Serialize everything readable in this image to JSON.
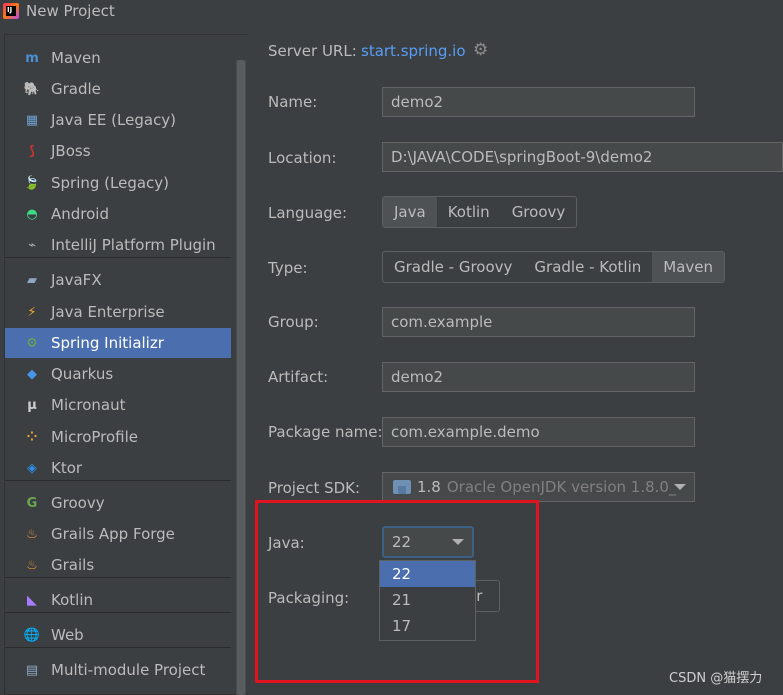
{
  "window": {
    "title": "New Project"
  },
  "sidebar": {
    "items": [
      {
        "label": "Maven",
        "icon": "maven-icon",
        "glyph": "m",
        "color": "#4b8fd6"
      },
      {
        "label": "Gradle",
        "icon": "gradle-icon",
        "glyph": "🐘",
        "color": "#a0a0a0"
      },
      {
        "label": "Java EE (Legacy)",
        "icon": "javaee-icon",
        "glyph": "▦",
        "color": "#6f9fd1"
      },
      {
        "label": "JBoss",
        "icon": "jboss-icon",
        "glyph": "⟆",
        "color": "#cc3333"
      },
      {
        "label": "Spring (Legacy)",
        "icon": "spring-leaf-icon",
        "glyph": "🍃",
        "color": "#6aa84f"
      },
      {
        "label": "Android",
        "icon": "android-icon",
        "glyph": "◓",
        "color": "#3ddc84"
      },
      {
        "label": "IntelliJ Platform Plugin",
        "icon": "plugin-icon",
        "glyph": "⌁",
        "color": "#aaaaaa"
      },
      {
        "label": "JavaFX",
        "icon": "javafx-icon",
        "glyph": "▰",
        "color": "#8fa7c4"
      },
      {
        "label": "Java Enterprise",
        "icon": "java-enterprise-icon",
        "glyph": "⚡",
        "color": "#f0a732"
      },
      {
        "label": "Spring Initializr",
        "icon": "spring-initializr-icon",
        "glyph": "⚙",
        "color": "#6aa84f"
      },
      {
        "label": "Quarkus",
        "icon": "quarkus-icon",
        "glyph": "◆",
        "color": "#4695eb"
      },
      {
        "label": "Micronaut",
        "icon": "micronaut-icon",
        "glyph": "μ",
        "color": "#cccccc"
      },
      {
        "label": "MicroProfile",
        "icon": "microprofile-icon",
        "glyph": "⁘",
        "color": "#f0a732"
      },
      {
        "label": "Ktor",
        "icon": "ktor-icon",
        "glyph": "◈",
        "color": "#2c8ee8"
      },
      {
        "label": "Groovy",
        "icon": "groovy-icon",
        "glyph": "G",
        "color": "#6aa84f"
      },
      {
        "label": "Grails App Forge",
        "icon": "grails-forge-icon",
        "glyph": "♨",
        "color": "#e8923c"
      },
      {
        "label": "Grails",
        "icon": "grails-icon",
        "glyph": "♨",
        "color": "#e8923c"
      },
      {
        "label": "Kotlin",
        "icon": "kotlin-icon",
        "glyph": "◣",
        "color": "#a97bff"
      },
      {
        "label": "Web",
        "icon": "globe-icon",
        "glyph": "🌐",
        "color": "#aaaaaa"
      },
      {
        "label": "Multi-module Project",
        "icon": "module-icon",
        "glyph": "▤",
        "color": "#8fa7c4"
      }
    ],
    "selected": "Spring Initializr"
  },
  "form": {
    "server_url_label": "Server URL:",
    "server_url": "start.spring.io",
    "name_label": "Name:",
    "name_value": "demo2",
    "location_label": "Location:",
    "location_value": "D:\\JAVA\\CODE\\springBoot-9\\demo2",
    "language_label": "Language:",
    "language_options": [
      "Java",
      "Kotlin",
      "Groovy"
    ],
    "language_selected": "Java",
    "type_label": "Type:",
    "type_options": [
      "Gradle - Groovy",
      "Gradle - Kotlin",
      "Maven"
    ],
    "type_selected": "Maven",
    "group_label": "Group:",
    "group_value": "com.example",
    "artifact_label": "Artifact:",
    "artifact_value": "demo2",
    "package_label": "Package name:",
    "package_value": "com.example.demo",
    "sdk_label": "Project SDK:",
    "sdk_version": "1.8",
    "sdk_name": "Oracle OpenJDK version 1.8.0_",
    "java_label": "Java:",
    "java_selected": "22",
    "java_options": [
      "22",
      "21",
      "17"
    ],
    "packaging_label": "Packaging:",
    "packaging_visible": "ar"
  },
  "watermark": "CSDN @猫摆力",
  "colors": {
    "accent": "#4b6eaf",
    "link": "#589df6",
    "highlight": "#e0141e"
  }
}
